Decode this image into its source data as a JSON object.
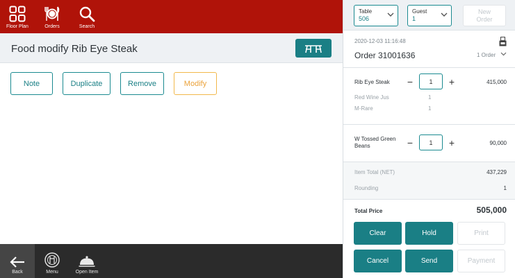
{
  "topbar": {
    "floor_plan": "Floor Plan",
    "orders": "Orders",
    "search": "Search"
  },
  "title": "Food modify Rib Eye Steak",
  "actions": {
    "note": "Note",
    "duplicate": "Duplicate",
    "remove": "Remove",
    "modify": "Modify"
  },
  "bottombar": {
    "back": "Back",
    "menu": "Menu",
    "open_item": "Open Item"
  },
  "selectors": {
    "table_label": "Table",
    "table_value": "506",
    "guest_label": "Guest",
    "guest_value": "1",
    "new_order_line1": "New",
    "new_order_line2": "Order"
  },
  "order": {
    "datetime": "2020-12-03 11:16:48",
    "name": "Order 31001636",
    "count": "1 Order",
    "items": [
      {
        "name": "Rib Eye Steak",
        "qty": "1",
        "price": "415,000",
        "modifiers": [
          {
            "name": "Red Wine Jus",
            "qty": "1"
          },
          {
            "name": "M-Rare",
            "qty": "1"
          }
        ]
      },
      {
        "name": "W Tossed Green Beans",
        "qty": "1",
        "price": "90,000",
        "modifiers": []
      }
    ]
  },
  "totals": {
    "item_total_label": "Item Total (NET)",
    "item_total_value": "437,229",
    "rounding_label": "Rounding",
    "rounding_value": "1",
    "total_price_label": "Total Price",
    "total_price_value": "505,000"
  },
  "payment_actions": {
    "clear": "Clear",
    "hold": "Hold",
    "print": "Print",
    "cancel": "Cancel",
    "send": "Send",
    "payment": "Payment"
  },
  "colors": {
    "header_red": "#b01309",
    "teal": "#1a7f85",
    "modify_orange": "#eba23a",
    "bottom_dark": "#2b2b2b"
  }
}
